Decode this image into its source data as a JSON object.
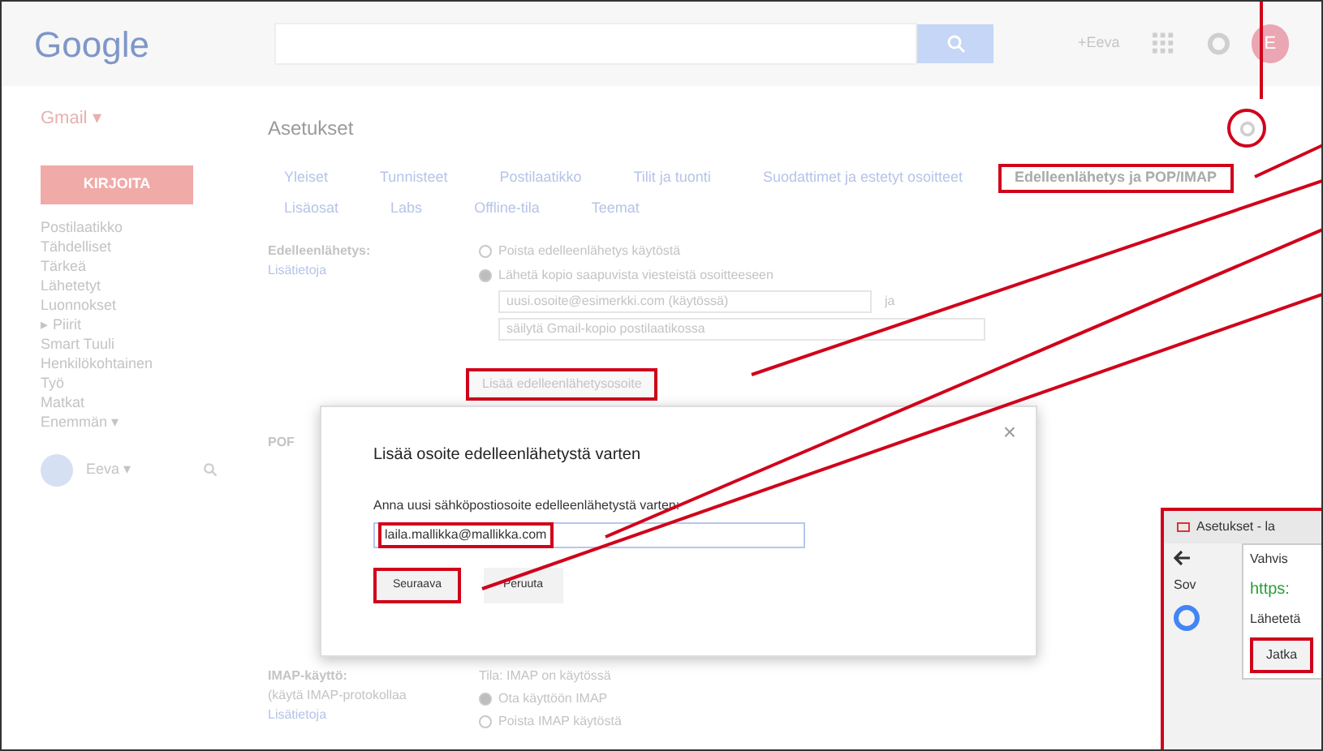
{
  "header": {
    "logo": "Google",
    "account_text": "+Eeva",
    "avatar_letter": "E"
  },
  "sidebar": {
    "app_menu": "Gmail ▾",
    "compose": "KIRJOITA",
    "items": [
      {
        "label": "Postilaatikko",
        "selected": false
      },
      {
        "label": "Tähdelliset",
        "selected": false
      },
      {
        "label": "Tärkeä",
        "selected": false
      },
      {
        "label": "Lähetetyt",
        "selected": false
      },
      {
        "label": "Luonnokset",
        "selected": false
      },
      {
        "label": "▸ Piirit",
        "selected": false
      },
      {
        "label": "Smart Tuuli",
        "selected": false
      },
      {
        "label": "Henkilökohtainen",
        "selected": false
      },
      {
        "label": "Työ",
        "selected": false
      },
      {
        "label": "Matkat",
        "selected": false
      },
      {
        "label": "Enemmän ▾",
        "selected": false
      }
    ],
    "user": "Eeva ▾"
  },
  "page_title": "Asetukset",
  "tabs": [
    {
      "label": "Yleiset",
      "selected": false,
      "highlighted": false
    },
    {
      "label": "Tunnisteet",
      "selected": false,
      "highlighted": false
    },
    {
      "label": "Postilaatikko",
      "selected": false,
      "highlighted": false
    },
    {
      "label": "Tilit ja tuonti",
      "selected": false,
      "highlighted": false
    },
    {
      "label": "Suodattimet ja estetyt osoitteet",
      "selected": false,
      "highlighted": false
    },
    {
      "label": "Edelleenlähetys ja POP/IMAP",
      "selected": true,
      "highlighted": true
    },
    {
      "label": "Lisäosat",
      "selected": false,
      "highlighted": false
    },
    {
      "label": "Labs",
      "selected": false,
      "highlighted": false
    },
    {
      "label": "Offline-tila",
      "selected": false,
      "highlighted": false
    },
    {
      "label": "Teemat",
      "selected": false,
      "highlighted": false
    }
  ],
  "forwarding": {
    "label": "Edelleenlähetys:",
    "link": "Lisätietoja",
    "options": [
      {
        "label": "Poista edelleenlähetys käytöstä",
        "selected": false
      },
      {
        "label": "Lähetä kopio saapuvista viesteistä osoitteeseen",
        "selected": true
      }
    ],
    "address_select": "uusi.osoite@esimerkki.com (käytössä)",
    "connector": "ja",
    "action_select": "säilytä Gmail-kopio postilaatikossa",
    "add_button": "Lisää edelleenlähetysosoite",
    "add_button_highlighted": true
  },
  "pop": {
    "label": "POF"
  },
  "imap": {
    "label": "IMAP-käyttö:",
    "note": "(käytä IMAP-protokollaa",
    "link": "Lisätietoja",
    "status": "Tila: IMAP on käytössä",
    "options": [
      {
        "label": "Ota käyttöön IMAP",
        "selected": true
      },
      {
        "label": "Poista IMAP käytöstä",
        "selected": false
      }
    ]
  },
  "dialog": {
    "title": "Lisää osoite edelleenlähetystä varten",
    "close": "×",
    "field_label": "Anna uusi sähköpostiosoite edelleenlähetystä varten:",
    "field_value": "laila.mallikka@mallikka.com",
    "field_highlighted": true,
    "buttons": [
      {
        "label": "Seuraava",
        "highlighted": true
      },
      {
        "label": "Peruuta",
        "highlighted": false
      }
    ]
  },
  "inset": {
    "tab_title": "Asetukset - la",
    "popup_title": "Vahvis",
    "url": "https:",
    "bookmark": "Sov",
    "message": "Lähetetä",
    "button": "Jatka",
    "button_highlighted": true
  }
}
